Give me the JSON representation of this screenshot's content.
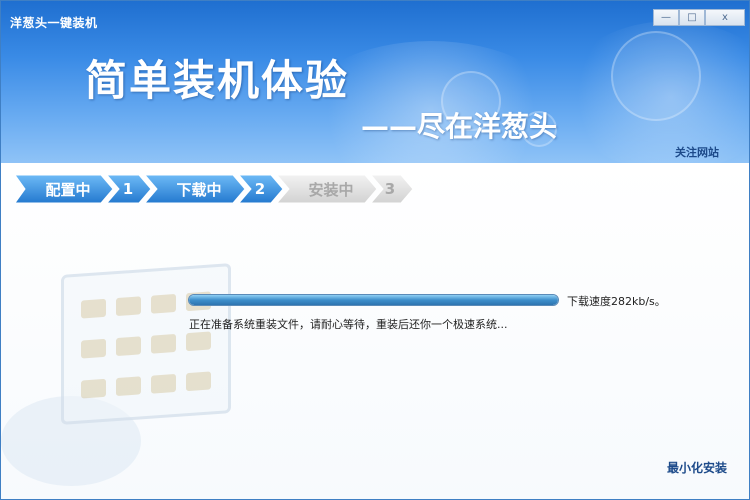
{
  "window": {
    "title": "洋葱头一键装机"
  },
  "controls": {
    "minimize": "—",
    "maximize": "□",
    "close": "x"
  },
  "banner": {
    "slogan_main": "简单装机体验",
    "slogan_sub": "——尽在洋葱头",
    "follow_link": "关注网站"
  },
  "steps": [
    {
      "label": "配置中",
      "number": "1",
      "state": "active"
    },
    {
      "label": "下载中",
      "number": "2",
      "state": "active"
    },
    {
      "label": "安装中",
      "number": "3",
      "state": "inactive"
    }
  ],
  "download": {
    "progress": 1.0,
    "speed_text": "下载速度282kb/s。",
    "status_text": "正在准备系统重装文件，请耐心等待，重装后还你一个极速系统..."
  },
  "footer": {
    "minimize_install": "最小化安装"
  },
  "colors": {
    "accent": "#2a82d6",
    "link": "#1d4a8a",
    "inactive": "#d4d4d4"
  }
}
